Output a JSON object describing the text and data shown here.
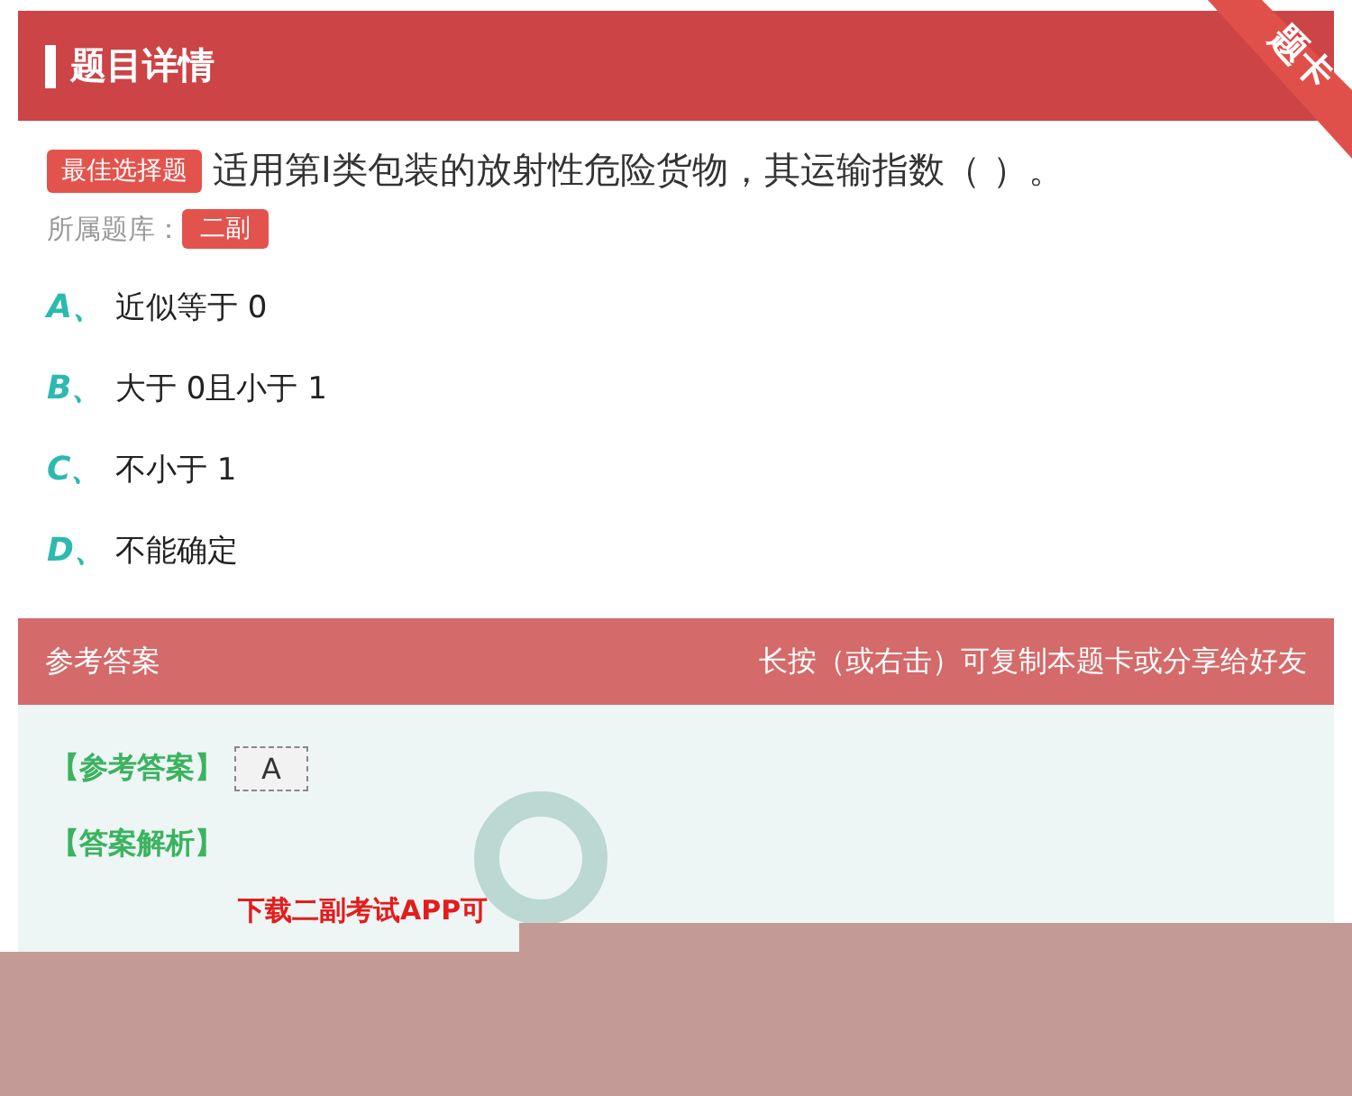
{
  "header": {
    "title": "题目详情",
    "corner_ribbon": "题卡"
  },
  "question": {
    "type_tag": "最佳选择题",
    "text": "适用第I类包装的放射性危险货物，其运输指数（   ）。",
    "bank_label": "所属题库：",
    "bank_tag": "二副"
  },
  "options": [
    {
      "letter": "A、",
      "text": "近似等于 0"
    },
    {
      "letter": "B、",
      "text": "大于 0且小于 1"
    },
    {
      "letter": "C、",
      "text": "不小于 1"
    },
    {
      "letter": "D、",
      "text": "不能确定"
    }
  ],
  "answer_bar": {
    "title": "参考答案",
    "hint": "长按（或右击）可复制本题卡或分享给好友"
  },
  "answer": {
    "answer_label": "【参考答案】",
    "answer_value": "A",
    "analysis_label": "【答案解析】",
    "download_text": "下载二副考试APP可"
  }
}
